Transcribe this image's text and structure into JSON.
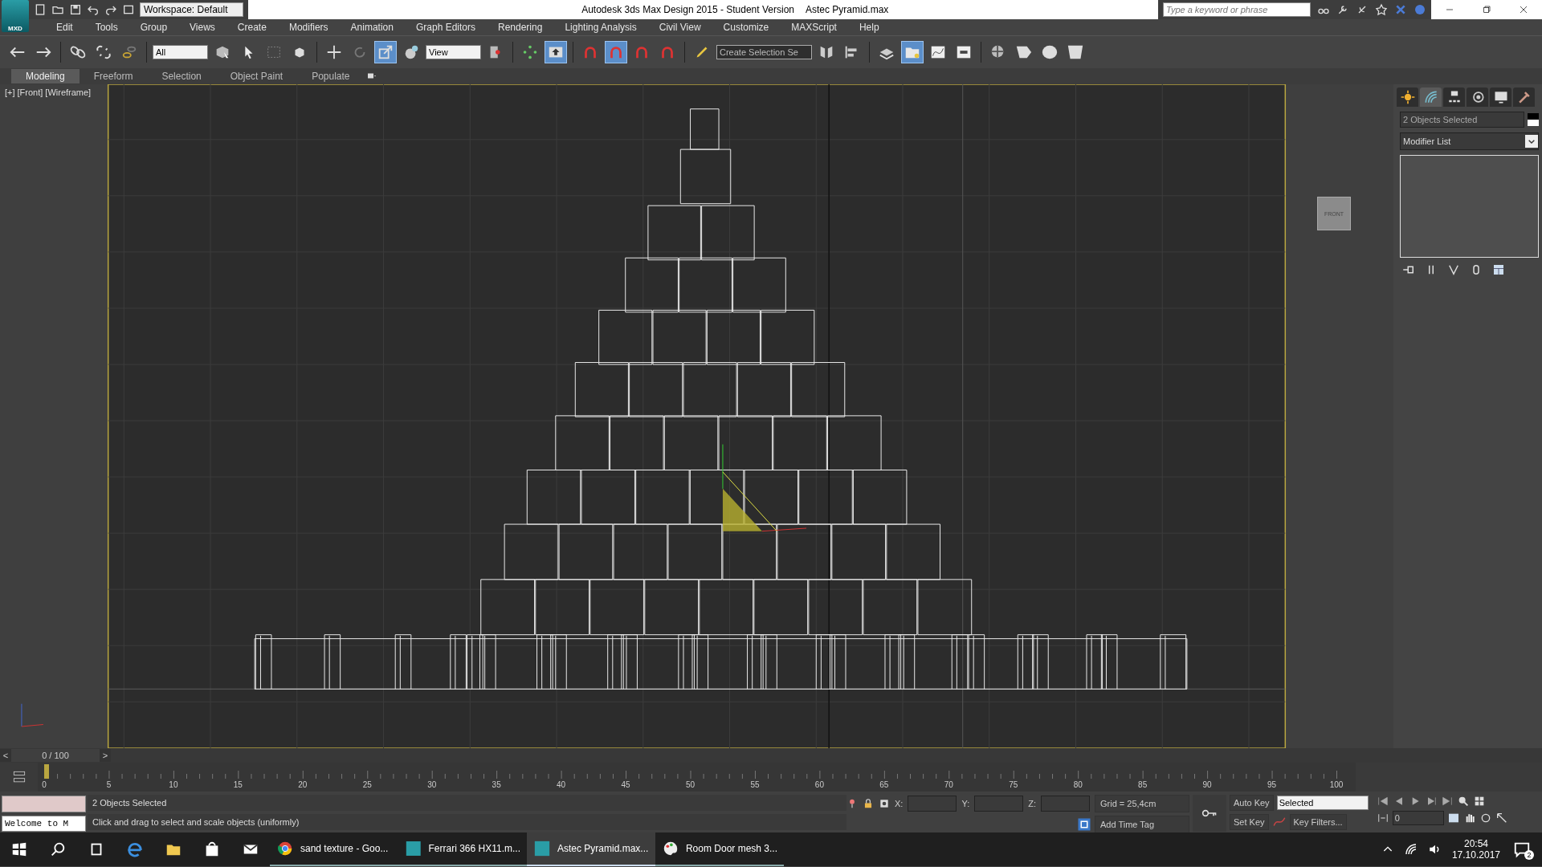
{
  "title_bar": {
    "app_badge": "MXD",
    "workspace": "Workspace: Default",
    "title": "Autodesk 3ds Max Design 2015  - Student Version",
    "file": "Astec Pyramid.max",
    "search": {
      "placeholder": "Type a keyword or phrase"
    }
  },
  "menu": [
    "Edit",
    "Tools",
    "Group",
    "Views",
    "Create",
    "Modifiers",
    "Animation",
    "Graph Editors",
    "Rendering",
    "Lighting Analysis",
    "Civil View",
    "Customize",
    "MAXScript",
    "Help"
  ],
  "main_toolbar": [
    {
      "kind": "button",
      "pressed": false
    },
    {
      "kind": "button",
      "pressed": false
    },
    {
      "kind": "separator"
    },
    {
      "kind": "button",
      "pressed": false
    },
    {
      "kind": "button",
      "pressed": false
    },
    {
      "kind": "button",
      "pressed": false
    },
    {
      "kind": "separator"
    },
    {
      "kind": "dropdown",
      "value": "All"
    },
    {
      "kind": "button",
      "pressed": false
    },
    {
      "kind": "button",
      "pressed": false
    },
    {
      "kind": "button",
      "pressed": false
    },
    {
      "kind": "button",
      "pressed": false
    },
    {
      "kind": "separator"
    },
    {
      "kind": "button",
      "pressed": false
    },
    {
      "kind": "button",
      "pressed": false
    },
    {
      "kind": "button",
      "pressed": true
    },
    {
      "kind": "button",
      "pressed": false
    },
    {
      "kind": "dropdown",
      "value": "View"
    },
    {
      "kind": "button",
      "pressed": false
    },
    {
      "kind": "separator"
    },
    {
      "kind": "button",
      "pressed": false
    },
    {
      "kind": "button",
      "pressed": true
    },
    {
      "kind": "separator"
    },
    {
      "kind": "button",
      "pressed": false
    },
    {
      "kind": "button",
      "pressed": true
    },
    {
      "kind": "button",
      "pressed": false
    },
    {
      "kind": "button",
      "pressed": false
    },
    {
      "kind": "separator"
    },
    {
      "kind": "button",
      "pressed": false
    },
    {
      "kind": "dropdown",
      "value": "Create Selection Se"
    },
    {
      "kind": "button",
      "pressed": false
    },
    {
      "kind": "button",
      "pressed": false
    },
    {
      "kind": "separator"
    },
    {
      "kind": "button",
      "pressed": false
    },
    {
      "kind": "button",
      "pressed": true
    },
    {
      "kind": "button",
      "pressed": false
    },
    {
      "kind": "button",
      "pressed": false
    },
    {
      "kind": "separator"
    },
    {
      "kind": "button",
      "pressed": false
    },
    {
      "kind": "button",
      "pressed": false
    },
    {
      "kind": "button",
      "pressed": false
    },
    {
      "kind": "button",
      "pressed": false
    }
  ],
  "ribbon_tabs": [
    {
      "label": "Modeling",
      "selected": true
    },
    {
      "label": "Freeform",
      "selected": false
    },
    {
      "label": "Selection",
      "selected": false
    },
    {
      "label": "Object Paint",
      "selected": false
    },
    {
      "label": "Populate",
      "selected": false
    }
  ],
  "viewport": {
    "labels": [
      "[+]",
      "[Front]",
      "[Wireframe]"
    ],
    "viewcube": "FRONT"
  },
  "command_panel": {
    "tabs": [
      {
        "selected": false
      },
      {
        "selected": true
      },
      {
        "selected": false
      },
      {
        "selected": false
      },
      {
        "selected": false
      },
      {
        "selected": false
      }
    ],
    "selection": "2 Objects Selected",
    "modifier_list": "Modifier List"
  },
  "timeline": {
    "level": 0,
    "prev": "<",
    "frame": "0 / 100",
    "next": ">",
    "ticks": [
      "0",
      "5",
      "10",
      "15",
      "20",
      "25",
      "30",
      "35",
      "40",
      "45",
      "50",
      "55",
      "60",
      "65",
      "70",
      "75",
      "80",
      "85",
      "90",
      "95",
      "100"
    ]
  },
  "status": {
    "listener": "Welcome to M",
    "selection": "2 Objects Selected",
    "prompt": "Click and drag to select and scale objects (uniformly)",
    "coords": [
      {
        "label": "X:"
      },
      {
        "label": "Y:"
      },
      {
        "label": "Z:"
      }
    ],
    "grid": "Grid = 25,4cm",
    "time_tag": "Add Time Tag",
    "auto_key": "Auto Key",
    "key_mode": "Selected",
    "set_key": "Set Key",
    "key_filters": "Key Filters...",
    "frame": "0"
  },
  "taskbar": {
    "apps": [
      {
        "label": "sand texture - Goo...",
        "selected": false
      },
      {
        "label": "Ferrari 366 HX11.m...",
        "selected": false
      },
      {
        "label": "Astec Pyramid.max...",
        "selected": true
      },
      {
        "label": "Room Door mesh 3...",
        "selected": false
      }
    ],
    "time": "20:54",
    "date": "17.10.2017",
    "notifications": "2"
  }
}
